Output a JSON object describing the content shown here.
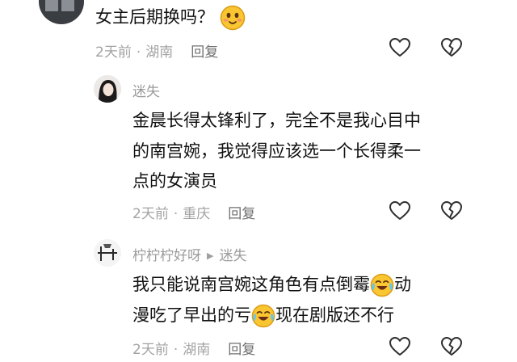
{
  "comments": [
    {
      "text": "女主后期换吗？",
      "meta": {
        "time": "2天前",
        "location": "湖南",
        "reply": "回复"
      }
    },
    {
      "author": "迷失",
      "lines": [
        "金晨长得太锋利了，完全不是我心目中",
        "的南宫婉，我觉得应该选一个长得柔一",
        "点的女演员"
      ],
      "meta": {
        "time": "2天前",
        "location": "重庆",
        "reply": "回复"
      }
    },
    {
      "author": "柠柠柠好呀",
      "reply_to": "迷失",
      "line1_a": "我只能说南宫婉这角色有点倒霉",
      "line1_b": "动",
      "line2_a": "漫吃了早出的亏",
      "line2_b": "现在剧版还不行",
      "meta": {
        "time": "2天前",
        "location": "湖南",
        "reply": "回复"
      }
    }
  ],
  "icons": [
    "like-heart-icon",
    "dislike-broken-heart-icon",
    "smile-emoji-icon",
    "cry-laugh-emoji-icon"
  ],
  "colors": {
    "primary_text": "#111111",
    "secondary_text": "#9b9b9b",
    "reply_text": "#6f6f6f",
    "icon_stroke": "#2e2e2e"
  }
}
